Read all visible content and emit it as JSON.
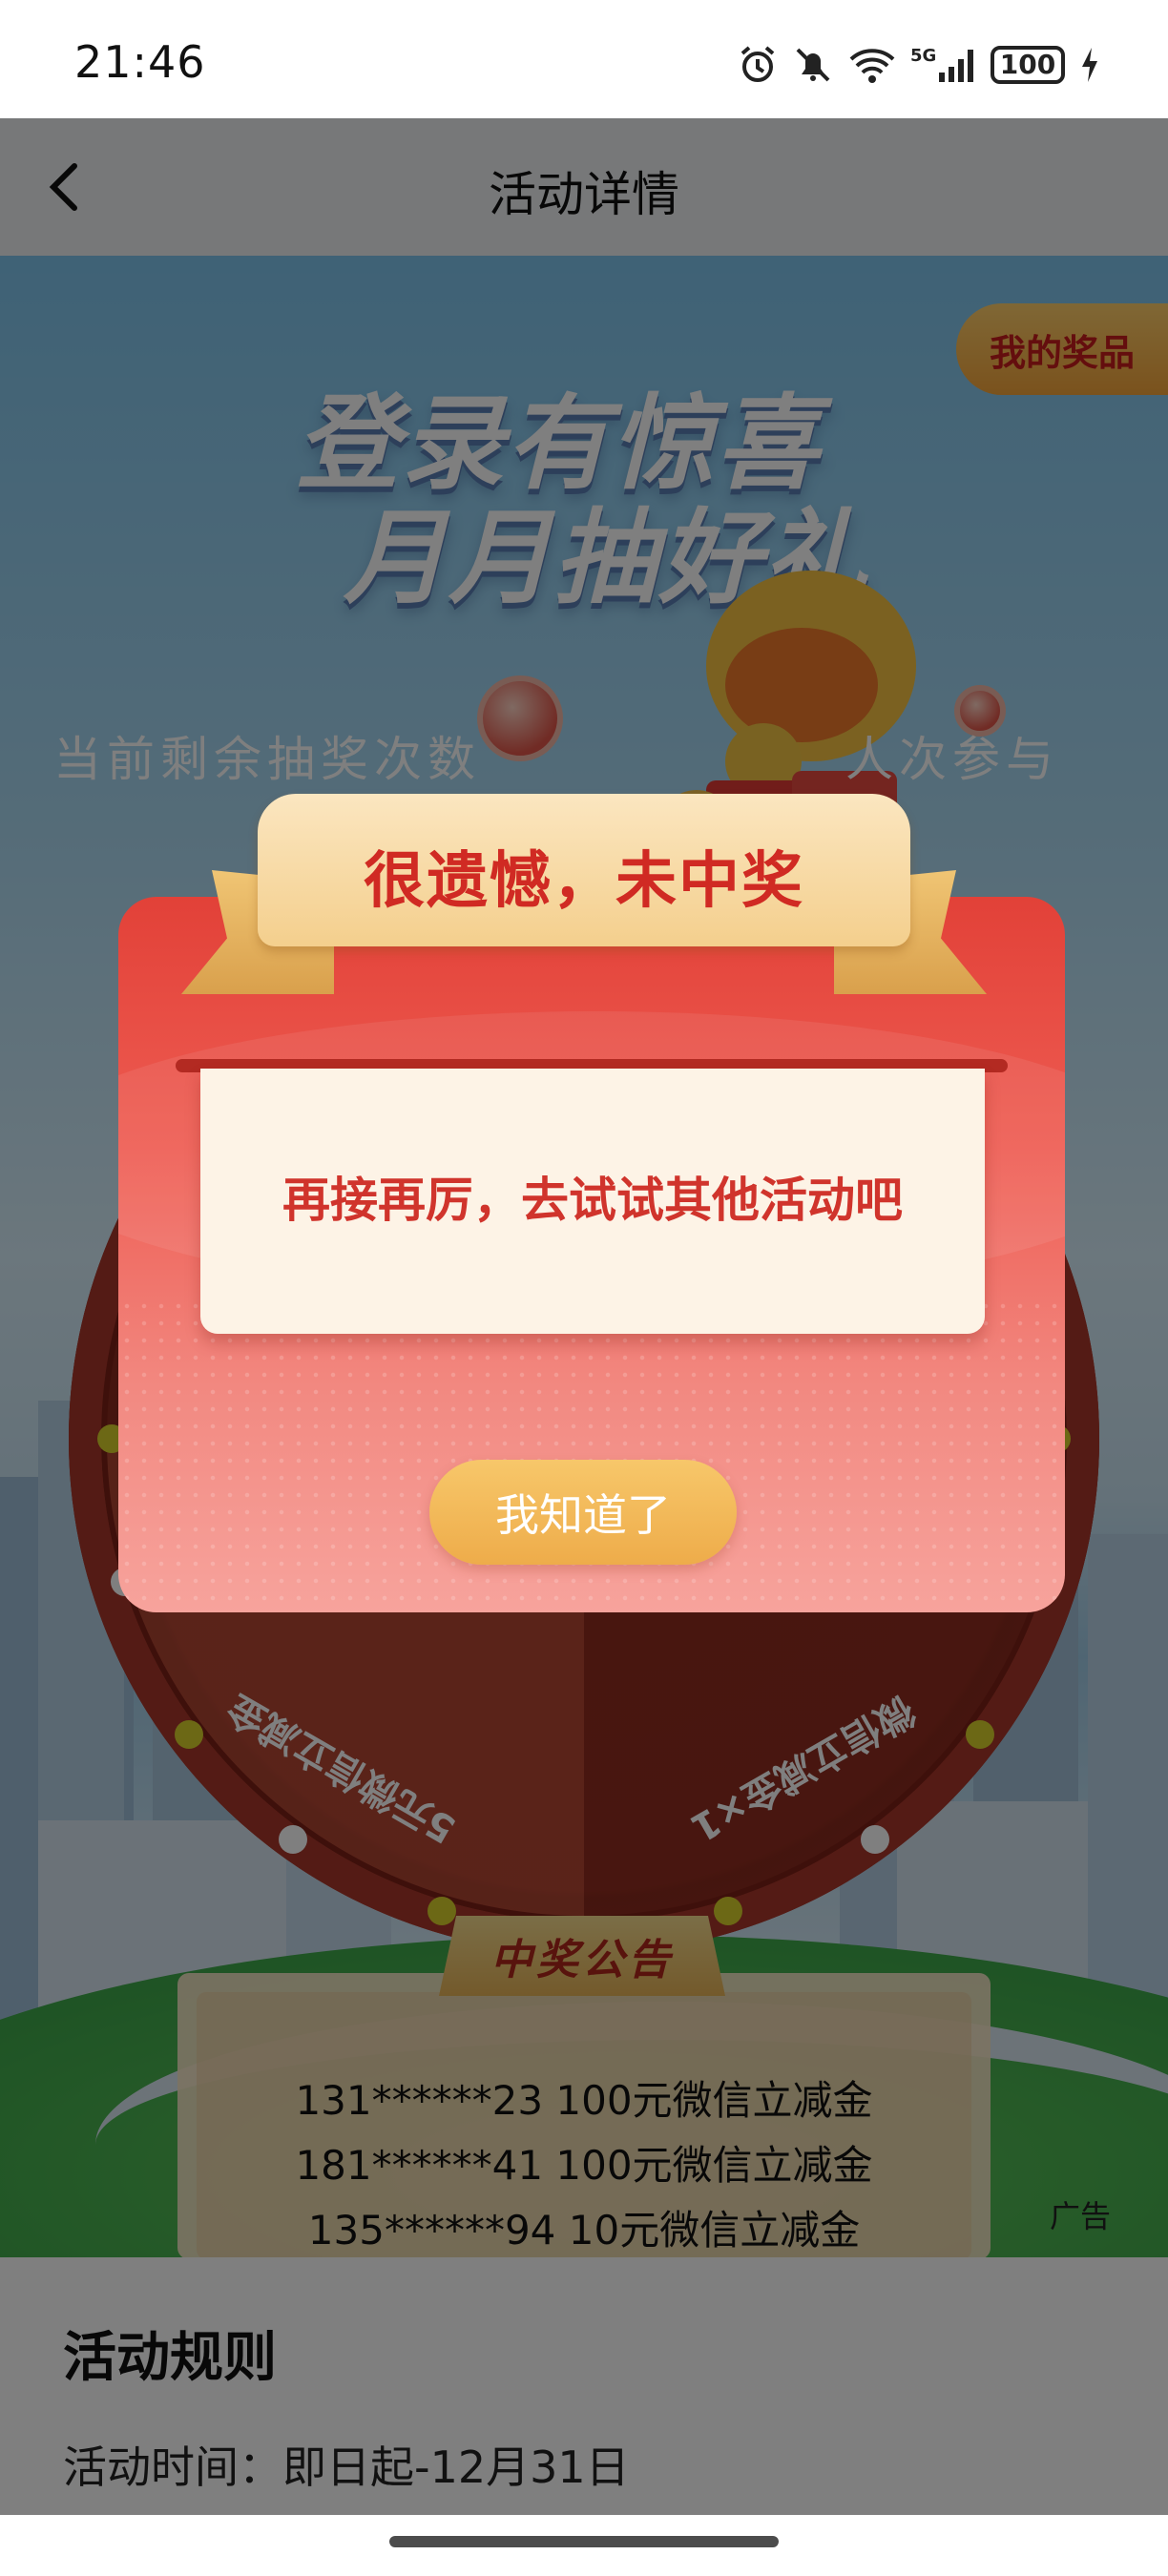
{
  "status_bar": {
    "time": "21:46",
    "battery": "100",
    "network": "5G"
  },
  "nav": {
    "title": "活动详情"
  },
  "hero": {
    "title_line1": "登录有惊喜",
    "title_line2": "月月抽好礼",
    "my_prizes": "我的奖品",
    "remaining_left": "当前剩余抽奖次数",
    "remaining_right": "人次参与"
  },
  "wheel": {
    "prize_left": "5元微信立减金",
    "prize_right": "微信立减金×1"
  },
  "notice": {
    "title": "中奖公告",
    "winners": [
      "131******23 100元微信立减金",
      "181******41 100元微信立减金",
      "135******94 10元微信立减金"
    ],
    "ad_label": "广告"
  },
  "rules": {
    "title": "活动规则",
    "time": "活动时间：即日起-12月31日"
  },
  "modal": {
    "title": "很遗憾，未中奖",
    "message": "再接再厉，去试试其他活动吧",
    "ok_label": "我知道了"
  },
  "colors": {
    "modal_red": "#e24138",
    "ribbon_gold": "#f4cf8d",
    "button_gold": "#eeac4a",
    "message_red": "#d0342c"
  }
}
